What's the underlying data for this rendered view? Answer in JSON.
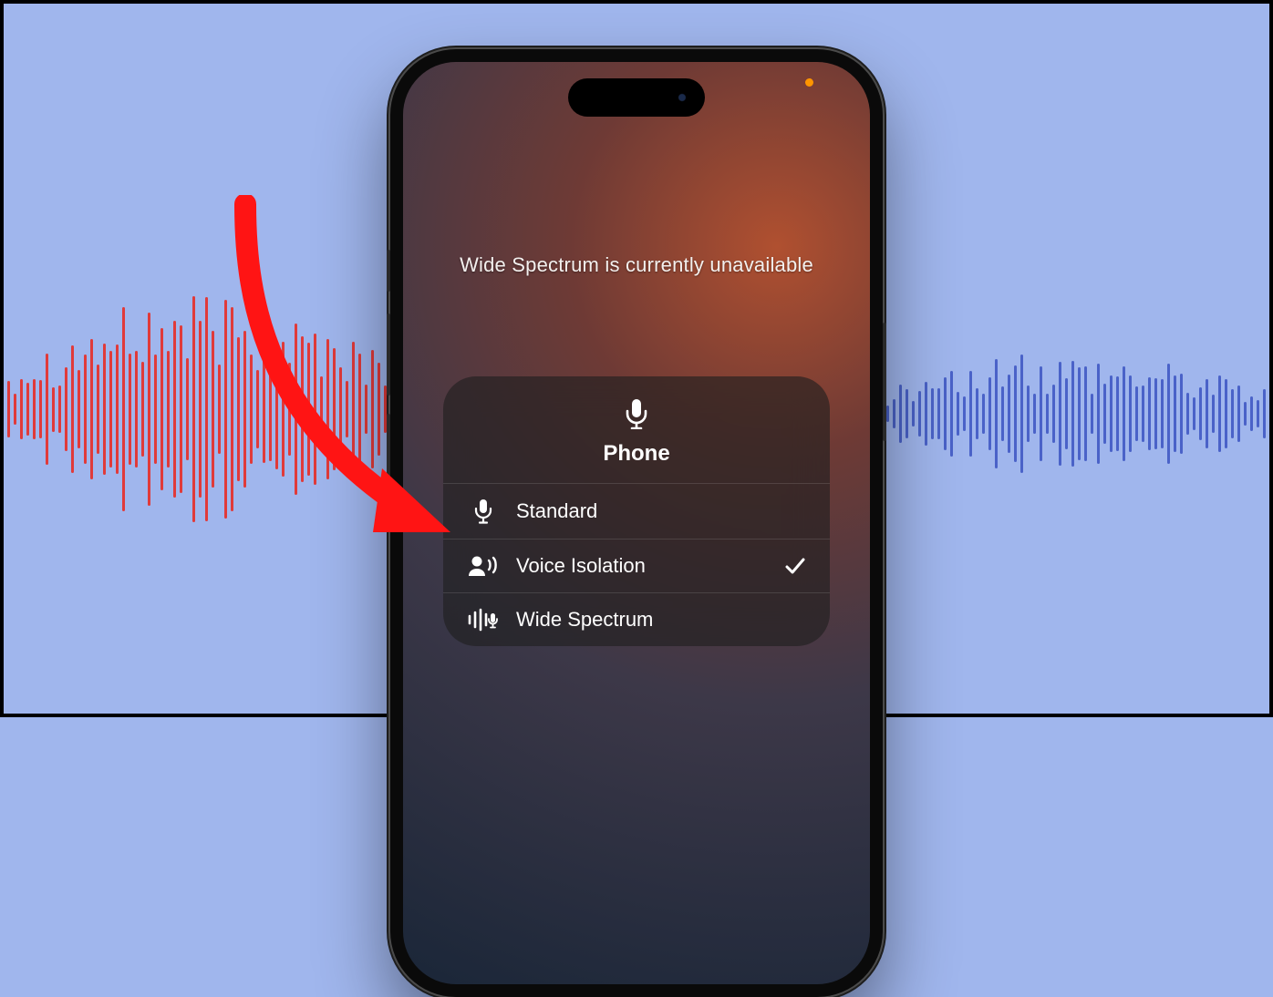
{
  "status_message": "Wide Spectrum is currently unavailable",
  "panel": {
    "title": "Phone",
    "options": [
      {
        "label": "Standard",
        "icon": "microphone-icon",
        "selected": false
      },
      {
        "label": "Voice Isolation",
        "icon": "voice-isolation-icon",
        "selected": true
      },
      {
        "label": "Wide Spectrum",
        "icon": "wide-spectrum-icon",
        "selected": false
      }
    ]
  },
  "indicators": {
    "mic_active_dot_color": "#ff9500"
  },
  "annotation": {
    "arrow_color": "#ff1414",
    "waveform_left_color": "#e03a3a",
    "waveform_right_color": "#4a62c8"
  }
}
